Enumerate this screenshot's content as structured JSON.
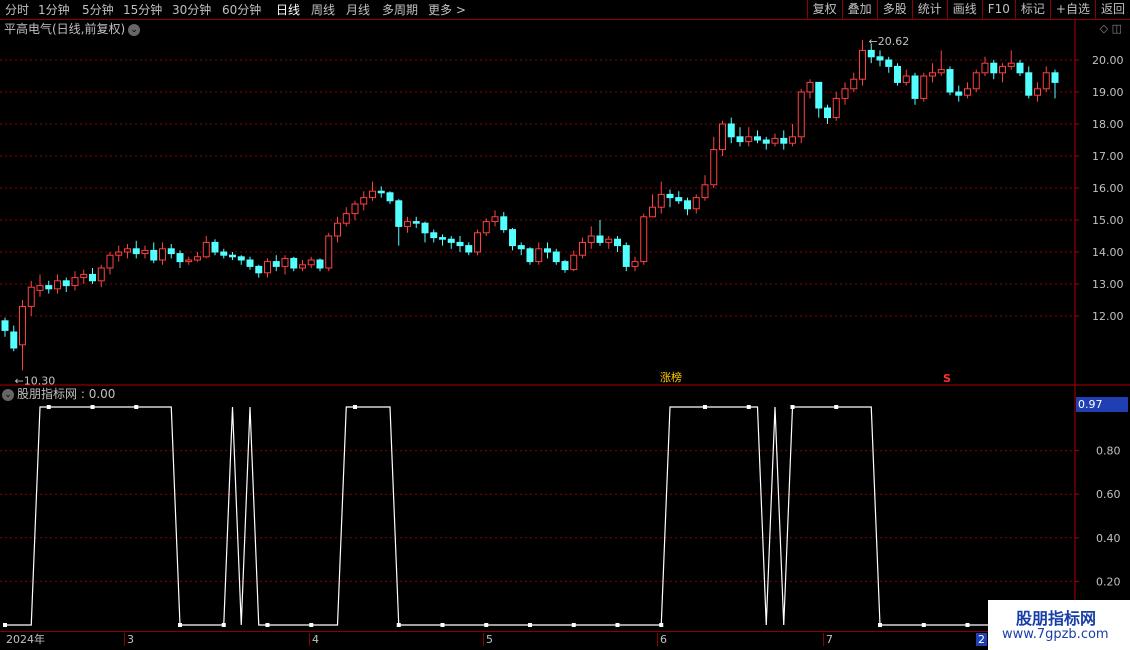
{
  "toolbar": {
    "periods": [
      "分时",
      "1分钟",
      "5分钟",
      "15分钟",
      "30分钟",
      "60分钟",
      "日线",
      "周线",
      "月线",
      "多周期",
      "更多"
    ],
    "more_arrow": ">",
    "active": "日线",
    "right_buttons": [
      "复权",
      "叠加",
      "多股",
      "统计",
      "画线",
      "F10",
      "标记",
      "+自选",
      "返回"
    ]
  },
  "chart_title": {
    "text": "平高电气(日线,前复权)",
    "chevron": "⌄"
  },
  "right_icons": "◇ ◫",
  "colors": {
    "up": "#ff4040",
    "down": "#54ffff",
    "grid": "#8b0000",
    "axis": "#b00000",
    "line": "#ffffff"
  },
  "price_labels": {
    "high": "20.62",
    "low": "10.30"
  },
  "markers": {
    "zt": "涨榜",
    "s": "S"
  },
  "indicator": {
    "name": "股朋指标网",
    "value": "0.00",
    "value_badge": "0.97"
  },
  "dates": {
    "year": "2024年",
    "months": [
      "3",
      "4",
      "5",
      "6",
      "7",
      "2"
    ]
  },
  "watermark": {
    "line1": "股朋指标网",
    "line2": "www.7gpzb.com"
  },
  "price_axis": [
    "20.00",
    "19.00",
    "18.00",
    "17.00",
    "16.00",
    "15.00",
    "14.00",
    "13.00",
    "12.00"
  ],
  "indicator_axis": [
    "0.80",
    "0.60",
    "0.40",
    "0.20"
  ],
  "chart_data": {
    "type": "candlestick",
    "candles": [
      [
        11.85,
        11.55,
        11.95,
        11.35
      ],
      [
        11.5,
        11.0,
        11.7,
        10.9
      ],
      [
        11.1,
        12.3,
        12.5,
        10.3
      ],
      [
        12.3,
        12.9,
        13.1,
        12.0
      ],
      [
        12.8,
        12.95,
        13.3,
        12.6
      ],
      [
        12.95,
        12.85,
        13.1,
        12.7
      ],
      [
        12.85,
        13.1,
        13.3,
        12.7
      ],
      [
        13.1,
        12.95,
        13.2,
        12.75
      ],
      [
        12.95,
        13.2,
        13.4,
        12.8
      ],
      [
        13.2,
        13.3,
        13.45,
        13.0
      ],
      [
        13.3,
        13.1,
        13.5,
        13.0
      ],
      [
        13.1,
        13.5,
        13.6,
        12.9
      ],
      [
        13.5,
        13.9,
        14.0,
        13.3
      ],
      [
        13.9,
        14.0,
        14.2,
        13.7
      ],
      [
        14.0,
        14.1,
        14.25,
        13.8
      ],
      [
        14.1,
        13.95,
        14.35,
        13.8
      ],
      [
        13.95,
        14.05,
        14.2,
        13.8
      ],
      [
        14.05,
        13.75,
        14.3,
        13.65
      ],
      [
        13.75,
        14.1,
        14.3,
        13.6
      ],
      [
        14.1,
        13.95,
        14.25,
        13.8
      ],
      [
        13.95,
        13.7,
        14.05,
        13.5
      ],
      [
        13.7,
        13.75,
        13.85,
        13.6
      ],
      [
        13.75,
        13.85,
        14.0,
        13.7
      ],
      [
        13.85,
        14.3,
        14.5,
        13.8
      ],
      [
        14.3,
        14.0,
        14.4,
        13.9
      ],
      [
        14.0,
        13.9,
        14.1,
        13.8
      ],
      [
        13.9,
        13.85,
        14.0,
        13.75
      ],
      [
        13.85,
        13.75,
        13.9,
        13.6
      ],
      [
        13.75,
        13.55,
        13.85,
        13.45
      ],
      [
        13.55,
        13.35,
        13.6,
        13.2
      ],
      [
        13.35,
        13.7,
        13.8,
        13.2
      ],
      [
        13.7,
        13.55,
        13.9,
        13.4
      ],
      [
        13.55,
        13.8,
        13.9,
        13.3
      ],
      [
        13.8,
        13.5,
        13.85,
        13.4
      ],
      [
        13.5,
        13.6,
        13.75,
        13.4
      ],
      [
        13.6,
        13.75,
        13.85,
        13.5
      ],
      [
        13.75,
        13.5,
        13.8,
        13.4
      ],
      [
        13.5,
        14.5,
        14.6,
        13.4
      ],
      [
        14.5,
        14.9,
        15.1,
        14.3
      ],
      [
        14.9,
        15.2,
        15.4,
        14.8
      ],
      [
        15.2,
        15.5,
        15.6,
        15.0
      ],
      [
        15.5,
        15.7,
        15.9,
        15.3
      ],
      [
        15.7,
        15.9,
        16.2,
        15.6
      ],
      [
        15.9,
        15.85,
        16.05,
        15.7
      ],
      [
        15.85,
        15.6,
        15.9,
        15.5
      ],
      [
        15.6,
        14.8,
        15.65,
        14.2
      ],
      [
        14.8,
        14.95,
        15.1,
        14.6
      ],
      [
        14.95,
        14.9,
        15.1,
        14.75
      ],
      [
        14.9,
        14.6,
        14.95,
        14.3
      ],
      [
        14.6,
        14.45,
        14.7,
        14.3
      ],
      [
        14.45,
        14.4,
        14.55,
        14.2
      ],
      [
        14.4,
        14.3,
        14.5,
        14.1
      ],
      [
        14.3,
        14.2,
        14.5,
        14.0
      ],
      [
        14.2,
        14.0,
        14.3,
        13.9
      ],
      [
        14.0,
        14.6,
        14.7,
        13.9
      ],
      [
        14.6,
        14.95,
        15.05,
        14.5
      ],
      [
        14.95,
        15.1,
        15.3,
        14.8
      ],
      [
        15.1,
        14.7,
        15.25,
        14.6
      ],
      [
        14.7,
        14.2,
        14.75,
        14.05
      ],
      [
        14.2,
        14.1,
        14.3,
        13.9
      ],
      [
        14.1,
        13.7,
        14.15,
        13.6
      ],
      [
        13.7,
        14.1,
        14.3,
        13.6
      ],
      [
        14.1,
        14.0,
        14.3,
        13.8
      ],
      [
        14.0,
        13.7,
        14.1,
        13.6
      ],
      [
        13.7,
        13.45,
        13.75,
        13.35
      ],
      [
        13.45,
        13.9,
        14.05,
        13.4
      ],
      [
        13.9,
        14.3,
        14.45,
        13.8
      ],
      [
        14.3,
        14.5,
        14.8,
        14.1
      ],
      [
        14.5,
        14.3,
        15.0,
        14.2
      ],
      [
        14.3,
        14.4,
        14.5,
        14.1
      ],
      [
        14.4,
        14.2,
        14.5,
        14.0
      ],
      [
        14.2,
        13.55,
        14.3,
        13.4
      ],
      [
        13.55,
        13.7,
        13.85,
        13.4
      ],
      [
        13.7,
        15.1,
        15.2,
        13.6
      ],
      [
        15.1,
        15.4,
        15.8,
        15.3
      ],
      [
        15.4,
        15.8,
        16.2,
        15.2
      ],
      [
        15.8,
        15.7,
        15.95,
        15.4
      ],
      [
        15.7,
        15.6,
        15.9,
        15.5
      ],
      [
        15.6,
        15.35,
        15.7,
        15.15
      ],
      [
        15.35,
        15.7,
        15.8,
        15.2
      ],
      [
        15.7,
        16.1,
        16.4,
        15.6
      ],
      [
        16.1,
        17.2,
        17.6,
        16.0
      ],
      [
        17.2,
        18.0,
        18.1,
        17.0
      ],
      [
        18.0,
        17.6,
        18.2,
        17.4
      ],
      [
        17.6,
        17.45,
        17.9,
        17.3
      ],
      [
        17.45,
        17.6,
        17.9,
        17.3
      ],
      [
        17.6,
        17.5,
        17.8,
        17.4
      ],
      [
        17.5,
        17.4,
        17.6,
        17.2
      ],
      [
        17.4,
        17.55,
        17.7,
        17.3
      ],
      [
        17.55,
        17.4,
        17.8,
        17.2
      ],
      [
        17.4,
        17.6,
        18.0,
        17.3
      ],
      [
        17.6,
        19.0,
        19.1,
        17.4
      ],
      [
        19.0,
        19.3,
        19.4,
        18.8
      ],
      [
        19.3,
        18.5,
        19.3,
        18.2
      ],
      [
        18.5,
        18.2,
        18.6,
        18.0
      ],
      [
        18.2,
        18.8,
        19.0,
        18.1
      ],
      [
        18.8,
        19.1,
        19.3,
        18.6
      ],
      [
        19.1,
        19.4,
        19.6,
        19.0
      ],
      [
        19.4,
        20.3,
        20.62,
        19.2
      ],
      [
        20.3,
        20.1,
        20.5,
        19.9
      ],
      [
        20.1,
        20.0,
        20.3,
        19.8
      ],
      [
        20.0,
        19.8,
        20.1,
        19.6
      ],
      [
        19.8,
        19.3,
        19.9,
        19.2
      ],
      [
        19.3,
        19.5,
        19.7,
        19.2
      ],
      [
        19.5,
        18.8,
        19.6,
        18.6
      ],
      [
        18.8,
        19.5,
        19.6,
        18.7
      ],
      [
        19.5,
        19.6,
        19.9,
        19.3
      ],
      [
        19.6,
        19.7,
        20.3,
        19.5
      ],
      [
        19.7,
        19.0,
        19.8,
        18.9
      ],
      [
        19.0,
        18.9,
        19.2,
        18.7
      ],
      [
        18.9,
        19.1,
        19.3,
        18.8
      ],
      [
        19.1,
        19.6,
        19.7,
        19.0
      ],
      [
        19.6,
        19.9,
        20.1,
        19.5
      ],
      [
        19.9,
        19.6,
        20.0,
        19.4
      ],
      [
        19.6,
        19.8,
        19.9,
        19.3
      ],
      [
        19.8,
        19.9,
        20.3,
        19.7
      ],
      [
        19.9,
        19.6,
        20.0,
        19.5
      ],
      [
        19.6,
        18.9,
        19.8,
        18.8
      ],
      [
        18.9,
        19.1,
        19.3,
        18.7
      ],
      [
        19.1,
        19.6,
        19.8,
        19.0
      ],
      [
        19.6,
        19.3,
        19.7,
        18.8
      ]
    ],
    "indicator_values": [
      0,
      0,
      0,
      0,
      1,
      1,
      1,
      1,
      1,
      1,
      1,
      1,
      1,
      1,
      1,
      1,
      1,
      1,
      1,
      1,
      0,
      0,
      0,
      0,
      0,
      0,
      1,
      0,
      1,
      0,
      0,
      0,
      0,
      0,
      0,
      0,
      0,
      0,
      0,
      1,
      1,
      1,
      1,
      1,
      1,
      0,
      0,
      0,
      0,
      0,
      0,
      0,
      0,
      0,
      0,
      0,
      0,
      0,
      0,
      0,
      0,
      0,
      0,
      0,
      0,
      0,
      0,
      0,
      0,
      0,
      0,
      0,
      0,
      0,
      0,
      0,
      1,
      1,
      1,
      1,
      1,
      1,
      1,
      1,
      1,
      1,
      1,
      0,
      1,
      0,
      1,
      1,
      1,
      1,
      1,
      1,
      1,
      1,
      1,
      1,
      0,
      0,
      0,
      0,
      0,
      0,
      0,
      0,
      0,
      0,
      0,
      0,
      0,
      0,
      0,
      0,
      0,
      0,
      0,
      0,
      0,
      0,
      0,
      0
    ]
  }
}
